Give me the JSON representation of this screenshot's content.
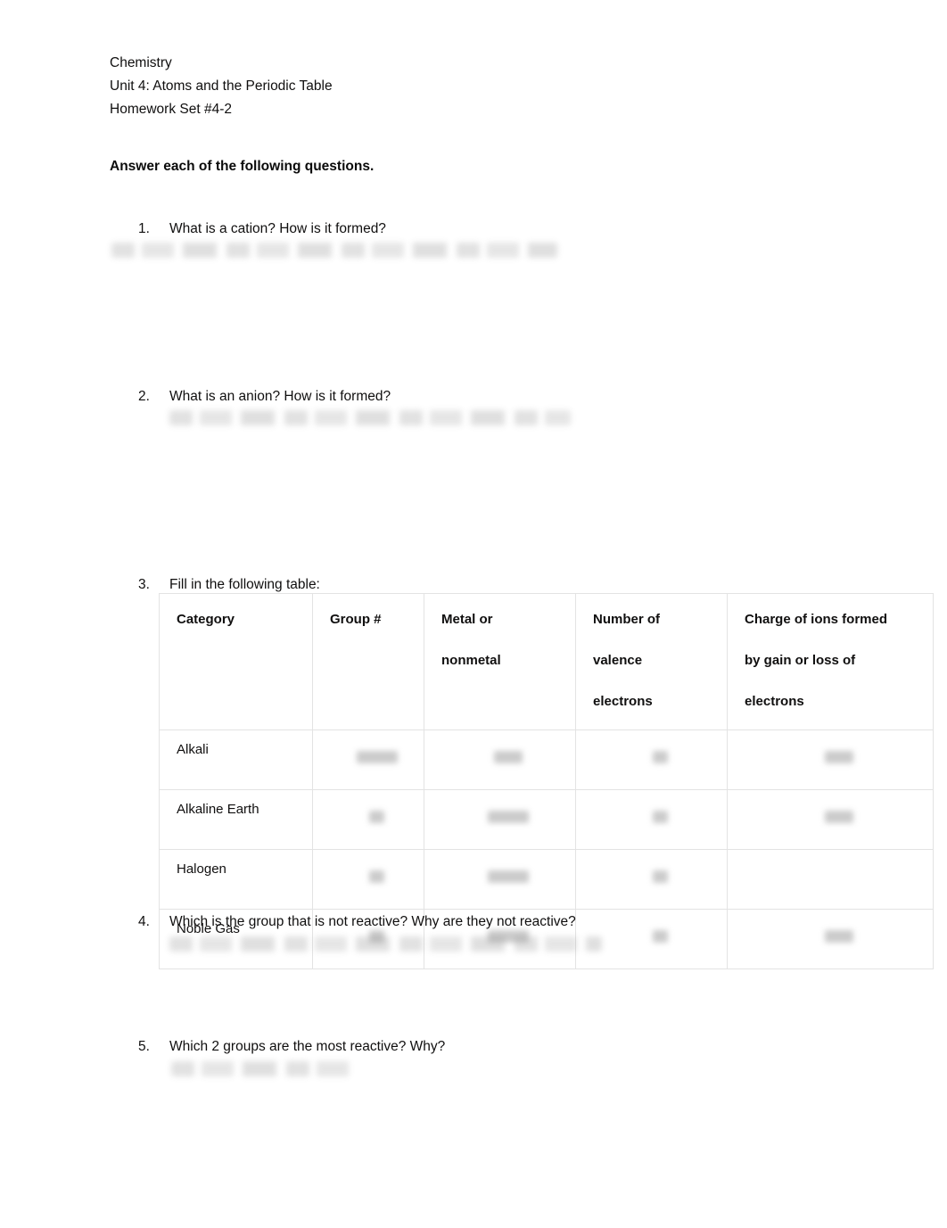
{
  "document": {
    "header": {
      "course": "Chemistry",
      "unit": "Unit 4: Atoms and the Periodic Table",
      "assignment": "Homework Set #4-2"
    },
    "instruction": "Answer each of the following questions."
  },
  "questions": [
    {
      "number": "1.",
      "text": "What is a cation?  How is it formed?",
      "answer_redacted": true
    },
    {
      "number": "2.",
      "text": "What is an anion? How is it formed?",
      "answer_redacted": true
    },
    {
      "number": "3.",
      "text": "Fill in the following table:",
      "answer_redacted": false
    },
    {
      "number": "4.",
      "text": "Which is the group that is not reactive?  Why are they not reactive?",
      "answer_redacted": true
    },
    {
      "number": "5.",
      "text": "Which 2 groups are the most reactive?  Why?",
      "answer_redacted": true
    }
  ],
  "table": {
    "headers": {
      "category": {
        "line1": "Category",
        "line2": "",
        "line3": ""
      },
      "group": {
        "line1": "Group #",
        "line2": "",
        "line3": ""
      },
      "metal": {
        "line1": "Metal or",
        "line2": "nonmetal",
        "line3": ""
      },
      "valence": {
        "line1": "Number of",
        "line2": "valence",
        "line3": "electrons"
      },
      "charge": {
        "line1": "Charge of ions formed",
        "line2": "by gain or loss of",
        "line3": "electrons"
      }
    },
    "rows": [
      {
        "category": "Alkali",
        "group": "",
        "metal": "",
        "valence": "",
        "charge": ""
      },
      {
        "category": "Alkaline Earth",
        "group": "",
        "metal": "",
        "valence": "",
        "charge": ""
      },
      {
        "category": "Halogen",
        "group": "",
        "metal": "",
        "valence": "",
        "charge": ""
      },
      {
        "category": "Noble Gas",
        "group": "",
        "metal": "",
        "valence": "",
        "charge": ""
      }
    ]
  },
  "colors": {
    "page_background": "#ffffff",
    "text": "#100f0f",
    "table_border": "#e3e3e3",
    "redaction_blur": "#8c8c8c"
  }
}
